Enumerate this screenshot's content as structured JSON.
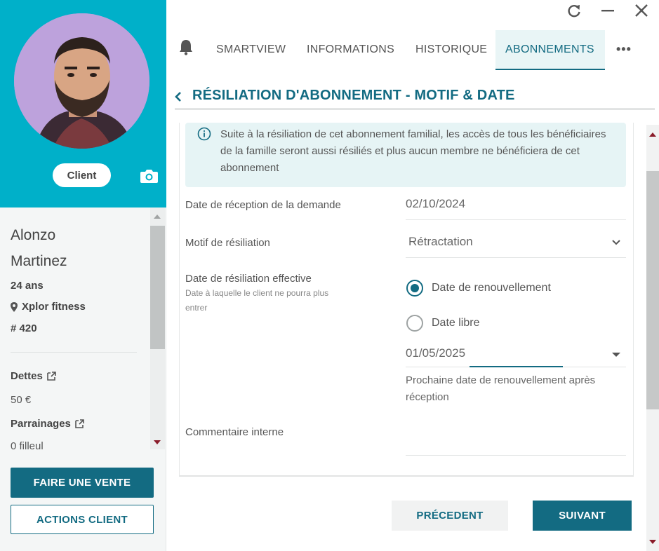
{
  "profile": {
    "badge": "Client",
    "first_name": "Alonzo",
    "last_name": "Martinez",
    "age": "24 ans",
    "location": "Xplor fitness",
    "member_id": "# 420",
    "debts_label": "Dettes",
    "debts_value": "50 €",
    "referrals_label": "Parrainages",
    "referrals_value": "0 filleul"
  },
  "sidebar_actions": {
    "sell_label": "FAIRE UNE VENTE",
    "client_actions_label": "ACTIONS CLIENT"
  },
  "tabs": [
    {
      "label": "SMARTVIEW",
      "active": false
    },
    {
      "label": "INFORMATIONS",
      "active": false
    },
    {
      "label": "HISTORIQUE",
      "active": false
    },
    {
      "label": "ABONNEMENTS",
      "active": true
    }
  ],
  "more_label": "•••",
  "page": {
    "title": "RÉSILIATION D'ABONNEMENT - MOTIF & DATE",
    "alert": "Suite à la résiliation de cet abonnement familial, les accès de tous les bénéficiaires de la famille seront aussi résiliés et plus aucun membre ne bénéficiera de cet abonnement"
  },
  "form": {
    "request_date_label": "Date de réception de la demande",
    "request_date_value": "02/10/2024",
    "reason_label": "Motif de résiliation",
    "reason_value": "Rétractation",
    "effective_date_label": "Date de résiliation effective",
    "effective_date_sub": "Date à laquelle le client ne pourra plus entrer",
    "option_renewal": "Date de renouvellement",
    "option_free": "Date libre",
    "selected_option": "Date de renouvellement",
    "effective_date_value": "01/05/2025",
    "effective_date_help": "Prochaine date de renouvellement après réception",
    "comment_label": "Commentaire interne",
    "comment_value": ""
  },
  "footer": {
    "prev_label": "PRÉCEDENT",
    "next_label": "SUIVANT"
  },
  "colors": {
    "hero": "#00b0c9",
    "primary": "#136b82",
    "alert_bg": "#e6f4f5"
  }
}
